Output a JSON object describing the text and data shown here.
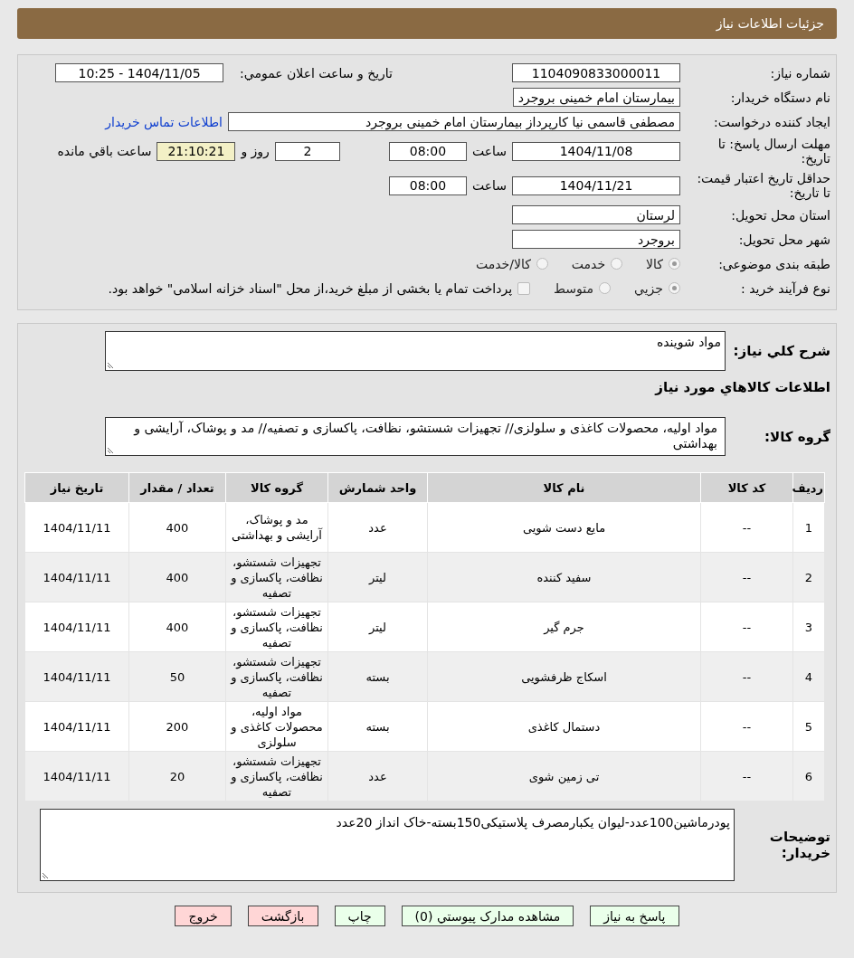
{
  "header": {
    "title": "جزئیات اطلاعات نیاز"
  },
  "need_number": {
    "label": "شماره نیاز:",
    "value": "1104090833000011"
  },
  "announce": {
    "label": "تاریخ و ساعت اعلان عمومي:",
    "value": "1404/11/05 - 10:25"
  },
  "buyer_org": {
    "label": "نام دستگاه خریدار:",
    "value": "بیمارستان امام خمینی بروجرد"
  },
  "creator": {
    "label": "ایجاد کننده درخواست:",
    "value": "مصطفی  قاسمی نیا کارپرداز بیمارستان امام خمینی بروجرد",
    "link": "اطلاعات تماس خریدار"
  },
  "deadline": {
    "label": "مهلت ارسال پاسخ: تا تاریخ:",
    "date": "1404/11/08",
    "time_label": "ساعت",
    "time": "08:00",
    "days": "2",
    "days_label": "روز و",
    "remaining": "21:10:21",
    "remaining_label": "ساعت باقي مانده"
  },
  "validity": {
    "label": "حداقل تاریخ اعتبار قیمت: تا تاریخ:",
    "date": "1404/11/21",
    "time_label": "ساعت",
    "time": "08:00"
  },
  "province": {
    "label": "استان محل تحویل:",
    "value": "لرستان"
  },
  "city": {
    "label": "شهر محل تحویل:",
    "value": "بروجرد"
  },
  "category": {
    "label": "طبقه بندی موضوعی:",
    "options": [
      {
        "label": "کالا",
        "selected": true
      },
      {
        "label": "خدمت",
        "selected": false
      },
      {
        "label": "کالا/خدمت",
        "selected": false
      }
    ]
  },
  "process": {
    "label": "نوع فرآیند خرید :",
    "options": [
      {
        "label": "جزيي",
        "selected": true
      },
      {
        "label": "متوسط",
        "selected": false
      }
    ],
    "payment": {
      "label": "پرداخت تمام یا بخشی از مبلغ خرید،از محل \"اسناد خزانه اسلامی\" خواهد بود.",
      "checked": false
    }
  },
  "description": {
    "label": "شرح کلي نیاز:",
    "value": "مواد شوینده"
  },
  "goods_heading": "اطلاعات کالاهاي مورد نیاز",
  "goods_group": {
    "label": "گروه کالا:",
    "value": "مواد اولیه، محصولات کاغذی و سلولزی// تجهیزات شستشو، نظافت، پاکسازی و تصفیه// مد و پوشاک، آرایشی و بهداشتی"
  },
  "table": {
    "columns": [
      "ردیف",
      "کد کالا",
      "نام کالا",
      "واحد شمارش",
      "گروه کالا",
      "تعداد / مقدار",
      "تاریخ نیاز"
    ],
    "rows": [
      [
        "1",
        "--",
        "مایع دست شویی",
        "عدد",
        "مد و پوشاک، آرایشی و بهداشتی",
        "400",
        "1404/11/11"
      ],
      [
        "2",
        "--",
        "سفید کننده",
        "لیتر",
        "تجهیزات شستشو، نظافت، پاکسازی و تصفیه",
        "400",
        "1404/11/11"
      ],
      [
        "3",
        "--",
        "جرم گیر",
        "لیتر",
        "تجهیزات شستشو، نظافت، پاکسازی و تصفیه",
        "400",
        "1404/11/11"
      ],
      [
        "4",
        "--",
        "اسکاج ظرفشویی",
        "بسته",
        "تجهیزات شستشو، نظافت، پاکسازی و تصفیه",
        "50",
        "1404/11/11"
      ],
      [
        "5",
        "--",
        "دستمال کاغذی",
        "بسته",
        "مواد اولیه، محصولات کاغذی و سلولزی",
        "200",
        "1404/11/11"
      ],
      [
        "6",
        "--",
        "تی زمین شوی",
        "عدد",
        "تجهیزات شستشو، نظافت، پاکسازی و تصفیه",
        "20",
        "1404/11/11"
      ]
    ]
  },
  "buyer_notes": {
    "label": "توضیحات خریدار:",
    "value": "پودرماشین100عدد-لیوان یکبارمصرف پلاستیکی150بسته-خاک انداز 20عدد"
  },
  "buttons": [
    {
      "label": "پاسخ به نیاز",
      "kind": "action"
    },
    {
      "label": "مشاهده مدارک پیوستي (0)",
      "kind": "action"
    },
    {
      "label": "چاپ",
      "kind": "action"
    },
    {
      "label": "بازگشت",
      "kind": "nav"
    },
    {
      "label": "خروج",
      "kind": "nav"
    }
  ]
}
